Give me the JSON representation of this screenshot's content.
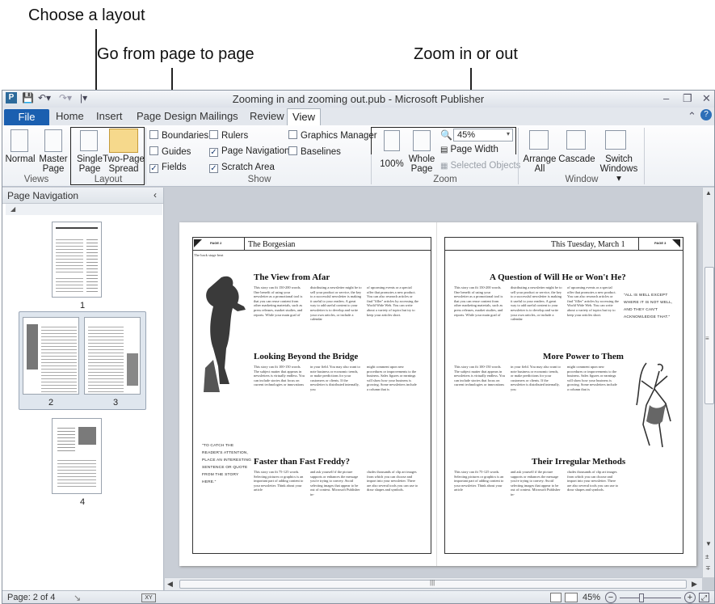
{
  "callouts": {
    "layout": "Choose a layout",
    "navigation": "Go from page to page",
    "zoom": "Zoom in or out"
  },
  "window": {
    "title": "Zooming in and zooming out.pub - Microsoft Publisher",
    "qat_icons": [
      "publisher-logo-icon",
      "save-icon",
      "undo-icon",
      "redo-icon",
      "customize-qat-icon"
    ]
  },
  "tabs": {
    "file": "File",
    "home": "Home",
    "insert": "Insert",
    "page_design": "Page Design",
    "mailings": "Mailings",
    "review": "Review",
    "view": "View"
  },
  "ribbon": {
    "views": {
      "normal": "Normal",
      "master_page_1": "Master",
      "master_page_2": "Page",
      "label": "Views"
    },
    "layout": {
      "single_1": "Single",
      "single_2": "Page",
      "two_1": "Two-Page",
      "two_2": "Spread",
      "label": "Layout"
    },
    "show": {
      "boundaries": "Boundaries",
      "guides": "Guides",
      "fields": "Fields",
      "rulers": "Rulers",
      "page_navigation": "Page Navigation",
      "scratch_area": "Scratch Area",
      "graphics_manager": "Graphics Manager",
      "baselines": "Baselines",
      "label": "Show"
    },
    "zoom": {
      "hundred": "100%",
      "whole_1": "Whole",
      "whole_2": "Page",
      "zoom_value": "45%",
      "page_width": "Page Width",
      "selected_objects": "Selected Objects",
      "label": "Zoom"
    },
    "window": {
      "arrange_1": "Arrange",
      "arrange_2": "All",
      "cascade": "Cascade",
      "switch_1": "Switch",
      "switch_2": "Windows",
      "label": "Window"
    }
  },
  "nav_pane": {
    "title": "Page Navigation",
    "pages": [
      "1",
      "2",
      "3",
      "4"
    ]
  },
  "document": {
    "left": {
      "page_tag": "PAGE 2",
      "header": "The Borgesian",
      "caption": "The back stage beat",
      "headline1": "The View from Afar",
      "col1a": "This story can fit 150-200 words. One benefit of using your newsletter as a promotional tool is that you can reuse content from other marketing materials, such as press releases, market studies, and reports. While your main goal of",
      "col1b": "distributing a newsletter might be to sell your product or service, the key to a successful newsletter is making it useful to your readers. A great way to add useful content to your newsletter is to develop and write your own articles, or include a calendar",
      "col1c": "of upcoming events or a special offer that promotes a new product. You can also research articles or find \"filler\" articles by accessing the World Wide Web. You can write about a variety of topics but try to keep your articles short.",
      "headline2": "Looking Beyond the Bridge",
      "col2a": "This story can fit 100-150 words. The subject matter that appears in newsletters is virtually endless. You can include stories that focus on current technologies or innovations",
      "col2b": "in your field. You may also want to note business or economic trends, or make predictions for your customers or clients. If the newsletter is distributed internally, you",
      "col2c": "might comment upon new procedures or improvements to the business. Sales figures or earnings will show how your business is growing. Some newsletters include a column that is",
      "quote": "\"TO CATCH THE READER'S ATTENTION, PLACE AN INTERESTING SENTENCE OR QUOTE FROM THE STORY HERE.\"",
      "headline3": "Faster than Fast Freddy?",
      "col3a": "This story can fit 75-125 words. Selecting pictures or graphics is an important part of adding content to your newsletter. Think about your article",
      "col3b": "and ask yourself if the picture supports or enhances the message you're trying to convey. Avoid selecting images that appear to be out of context. Microsoft Publisher in-",
      "col3c": "cludes thousands of clip art images from which you can choose and import into your newsletter. There are also several tools you can use to draw shapes and symbols."
    },
    "right": {
      "page_tag": "PAGE 3",
      "header": "This Tuesday, March 1",
      "headline1": "A Question of Will He or Won't He?",
      "col1a": "This story can fit 150-200 words. One benefit of using your newsletter as a promotional tool is that you can reuse content from other marketing materials, such as press releases, market studies, and reports. While your main goal of",
      "col1b": "distributing a newsletter might be to sell your product or service, the key to a successful newsletter is making it useful to your readers. A great way to add useful content to your newsletter is to develop and write your own articles, or include a calendar",
      "col1c": "of upcoming events or a special offer that promotes a new product. You can also research articles or find \"filler\" articles by accessing the World Wide Web. You can write about a variety of topics but try to keep your articles short.",
      "quote": "\"ALL IS WELL EXCEPT WHERE IT IS NOT WELL, AND THEY CAN'T ACKNOWLEDGE THAT.\"",
      "headline2": "More Power to Them",
      "col2a": "This story can fit 100-150 words. The subject matter that appears in newsletters is virtually endless. You can include stories that focus on current technologies or innovations",
      "col2b": "in your field. You may also want to note business or economic trends, or make predictions for your customers or clients. If the newsletter is distributed internally, you",
      "col2c": "might comment upon new procedures or improvements to the business. Sales figures or earnings will show how your business is growing. Some newsletters include a column that is",
      "headline3": "Their Irregular Methods",
      "col3a": "This story can fit 75-125 words. Selecting pictures or graphics is an important part of adding content to your newsletter. Think about your article",
      "col3b": "and ask yourself if the picture supports or enhances the message you're trying to convey. Avoid selecting images that appear to be out of context. Microsoft Publisher in-",
      "col3c": "cludes thousands of clip art images from which you can choose and import into your newsletter. There are also several tools you can use to draw shapes and symbols."
    }
  },
  "status": {
    "page": "Page: 2 of 4",
    "zoom": "45%"
  },
  "colors": {
    "file_tab": "#1a5fb0",
    "workspace": "#c9ced6"
  }
}
